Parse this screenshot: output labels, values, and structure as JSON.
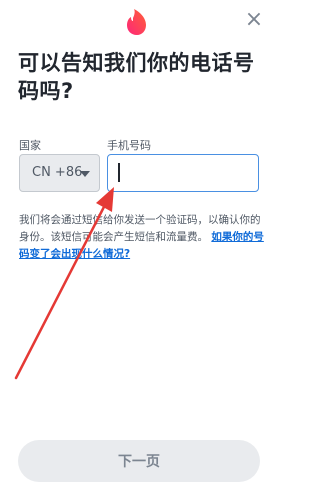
{
  "header": {
    "logo_icon": "tinder-flame-icon",
    "close_label": "×"
  },
  "title": "可以告知我们你的电话号码吗?",
  "form": {
    "country_label": "国家",
    "country_value": "CN +86",
    "phone_label": "手机号码",
    "phone_value": "",
    "phone_placeholder": ""
  },
  "help": {
    "text": "我们将会通过短信给你发送一个验证码，以确认你的身份。该短信可能会产生短信和流量费。",
    "link": "如果你的号码变了会出现什么情况?"
  },
  "footer": {
    "next_label": "下一页"
  },
  "colors": {
    "brand_gradient_start": "#fd267a",
    "brand_gradient_end": "#ff6036",
    "link": "#106bd8",
    "annotation_arrow": "#e53935"
  }
}
